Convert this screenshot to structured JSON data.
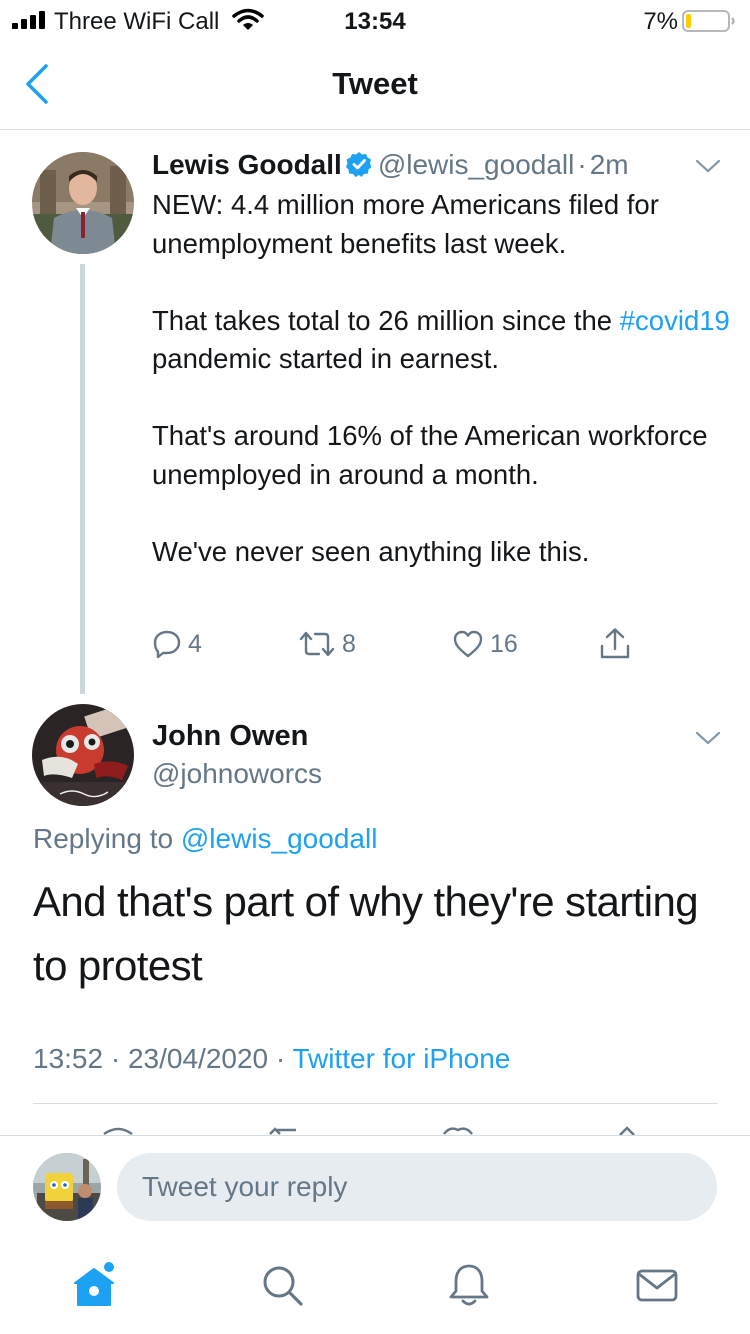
{
  "status_bar": {
    "carrier": "Three WiFi Call",
    "time": "13:54",
    "battery": "7%"
  },
  "nav": {
    "title": "Tweet"
  },
  "parent_tweet": {
    "author_name": "Lewis Goodall",
    "handle": "@lewis_goodall",
    "separator": "·",
    "age": "2m",
    "paragraphs": [
      "NEW: 4.4 million more Americans filed for unemployment benefits last week.",
      "That's around 16% of the American workforce unemployed in around a month.",
      "We've never seen anything like this."
    ],
    "paragraph_2": {
      "before": "That takes total to 26 million since the ",
      "hashtag": "#covid19",
      "after": " pandemic started in earnest."
    },
    "reply_count": "4",
    "retweet_count": "8",
    "like_count": "16"
  },
  "reply_tweet": {
    "author_name": "John Owen",
    "handle": "@johnoworcs",
    "replying_prefix": "Replying to",
    "replying_mention": "@lewis_goodall",
    "text": "And that's part of why they're starting to protest",
    "time": "13:52",
    "date": "23/04/2020",
    "separator": "·",
    "source": "Twitter for iPhone"
  },
  "composer": {
    "placeholder": "Tweet your reply"
  },
  "tab_bar": {
    "items": [
      "home-icon",
      "search-icon",
      "notifications-icon",
      "messages-icon"
    ],
    "active": "home-icon",
    "accent": "#1da1f2",
    "inactive": "#657786"
  },
  "colors": {
    "accent": "#1da1f2",
    "secondary_text": "#657786",
    "battery_low": "#ffcc00"
  }
}
